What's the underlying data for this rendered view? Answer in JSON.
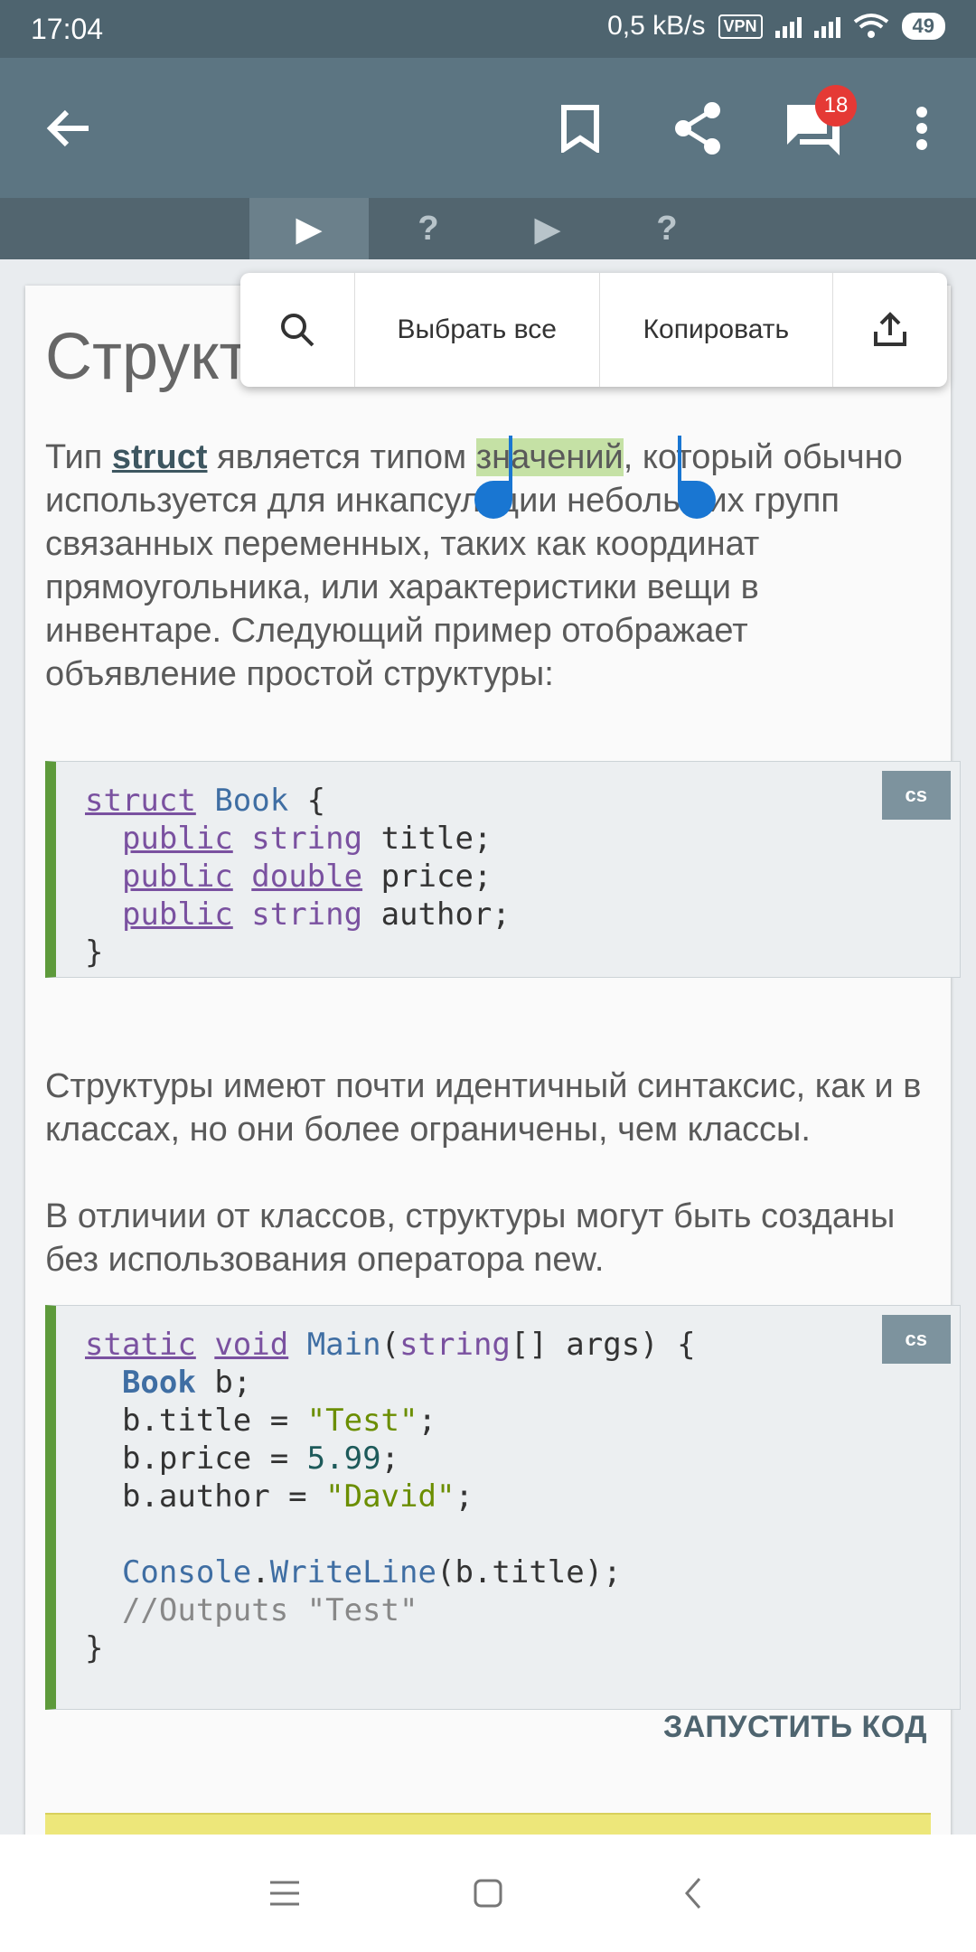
{
  "status": {
    "time": "17:04",
    "speed": "0,5 kB/s",
    "vpn": "VPN",
    "battery": "49"
  },
  "appbar": {
    "back_icon": "arrow-left-icon",
    "bookmark_icon": "bookmark-icon",
    "share_icon": "share-icon",
    "comments_icon": "comments-icon",
    "comments_count": "18",
    "more_icon": "more-vert-icon"
  },
  "tabs": [
    {
      "label": "▶",
      "active": true
    },
    {
      "label": "?"
    },
    {
      "label": "▶"
    },
    {
      "label": "?"
    }
  ],
  "lesson": {
    "title": "Структ",
    "para1": {
      "p1": "Тип ",
      "struct_link": "struct",
      "p2": " является типом ",
      "selected": "значений",
      "p3": ", который обычно используется для инкапсуляции небольших групп связанных переменных, таких как координат прямоугольника, или характеристики вещи в инвентаре. Следующий пример отображает объявление простой структуры:"
    },
    "code1_lang": "cs",
    "code1": {
      "l1_kw": "struct",
      "l1_cls": "Book",
      "l1_rest": " {",
      "l2_kw": "public",
      "l2_tp": "string",
      "l2_rest": " title;",
      "l3_kw": "public",
      "l3_tp": "double",
      "l3_rest": " price;",
      "l4_kw": "public",
      "l4_tp": "string",
      "l4_rest": " author;",
      "l5": "}"
    },
    "para2": "Структуры имеют почти идентичный синтаксис, как и в классах, но они более ограничены, чем классы.",
    "para3": "В отличии от классов, структуры могут быть созданы без использования оператора new.",
    "code2_lang": "cs",
    "code2": {
      "l1_kw1": "static",
      "l1_kw2": "void",
      "l1_cls": "Main",
      "l1_tp": "string",
      "l1_rest": "[] args) {",
      "l2_cls": "Book",
      "l2_rest": " b;",
      "l3_a": "b.title = ",
      "l3_str": "\"Test\"",
      "l3_b": ";",
      "l4_a": "b.price = ",
      "l4_num": "5.99",
      "l4_b": ";",
      "l5_a": "b.author = ",
      "l5_str": "\"David\"",
      "l5_b": ";",
      "l7_cls": "Console",
      "l7_m": "WriteLine",
      "l7_rest": "(b.title);",
      "l8_com": "//Outputs \"Test\"",
      "l9": "}"
    },
    "run_label": "ЗАПУСТИТЬ КОД"
  },
  "popup": {
    "search_icon": "search-icon",
    "select_all": "Выбрать все",
    "copy": "Копировать",
    "share_icon": "upload-share-icon"
  },
  "navbar": {
    "menu_icon": "menu-icon",
    "home_icon": "home-square-icon",
    "back_icon": "back-chevron-icon"
  }
}
